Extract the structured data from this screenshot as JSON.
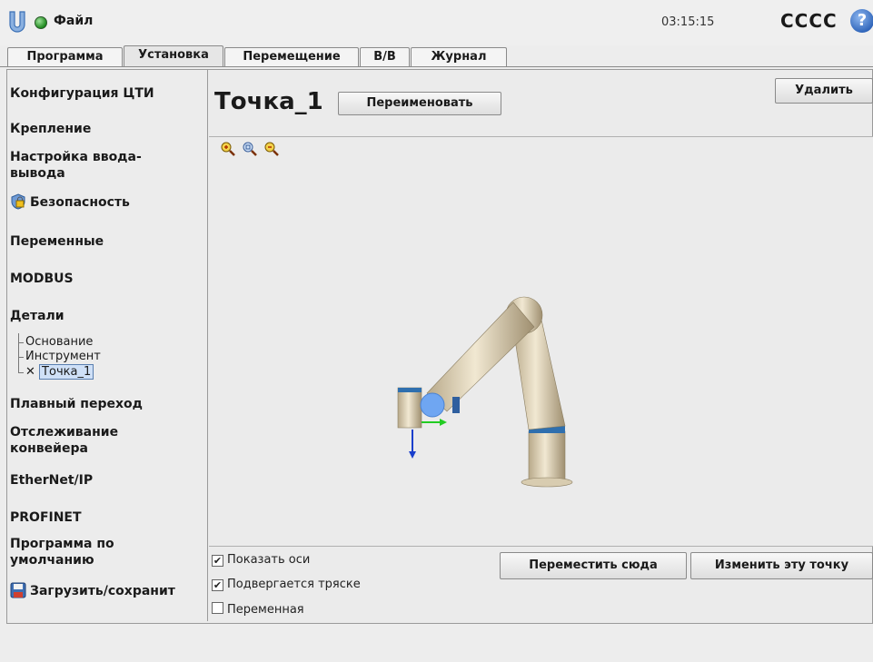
{
  "topbar": {
    "file_menu": "Файл",
    "clock": "03:15:15",
    "robot_name": "CCCC",
    "help_symbol": "?",
    "status_color": "#1f8a1f"
  },
  "tabs": [
    {
      "label": "Программа",
      "active": false
    },
    {
      "label": "Установка",
      "active": true
    },
    {
      "label": "Перемещение",
      "active": false
    },
    {
      "label": "В/В",
      "active": false
    },
    {
      "label": "Журнал",
      "active": false
    }
  ],
  "sidebar": {
    "items": [
      {
        "label": "Конфигурация ЦТИ"
      },
      {
        "label": "Крепление"
      },
      {
        "label": "Настройка ввода-вывода"
      },
      {
        "label": "Безопасность",
        "icon": "shield-lock-icon"
      },
      {
        "label": "Переменные"
      },
      {
        "label": "MODBUS"
      },
      {
        "label": "Детали"
      },
      {
        "label": "Плавный переход"
      },
      {
        "label": "Отслеживание конвейера"
      },
      {
        "label": "EtherNet/IP"
      },
      {
        "label": "PROFINET"
      },
      {
        "label": "Программа по умолчанию"
      },
      {
        "label": "Загрузить/сохранит",
        "icon": "floppy-disk-icon"
      }
    ],
    "features_tree": [
      {
        "label": "Основание"
      },
      {
        "label": "Инструмент"
      },
      {
        "label": "Точка_1",
        "selected": true,
        "icon": "point-feature-icon"
      }
    ]
  },
  "main": {
    "title": "Точка_1",
    "rename_button": "Переименовать",
    "delete_button": "Удалить",
    "move_here_button": "Переместить сюда",
    "change_point_button": "Изменить эту точку",
    "checkboxes": [
      {
        "label": "Показать оси",
        "checked": true
      },
      {
        "label": "Подвергается тряске",
        "checked": true
      },
      {
        "label": "Переменная",
        "checked": false
      }
    ],
    "zoom_icons": [
      "zoom-in-icon",
      "zoom-reset-icon",
      "zoom-out-icon"
    ]
  }
}
